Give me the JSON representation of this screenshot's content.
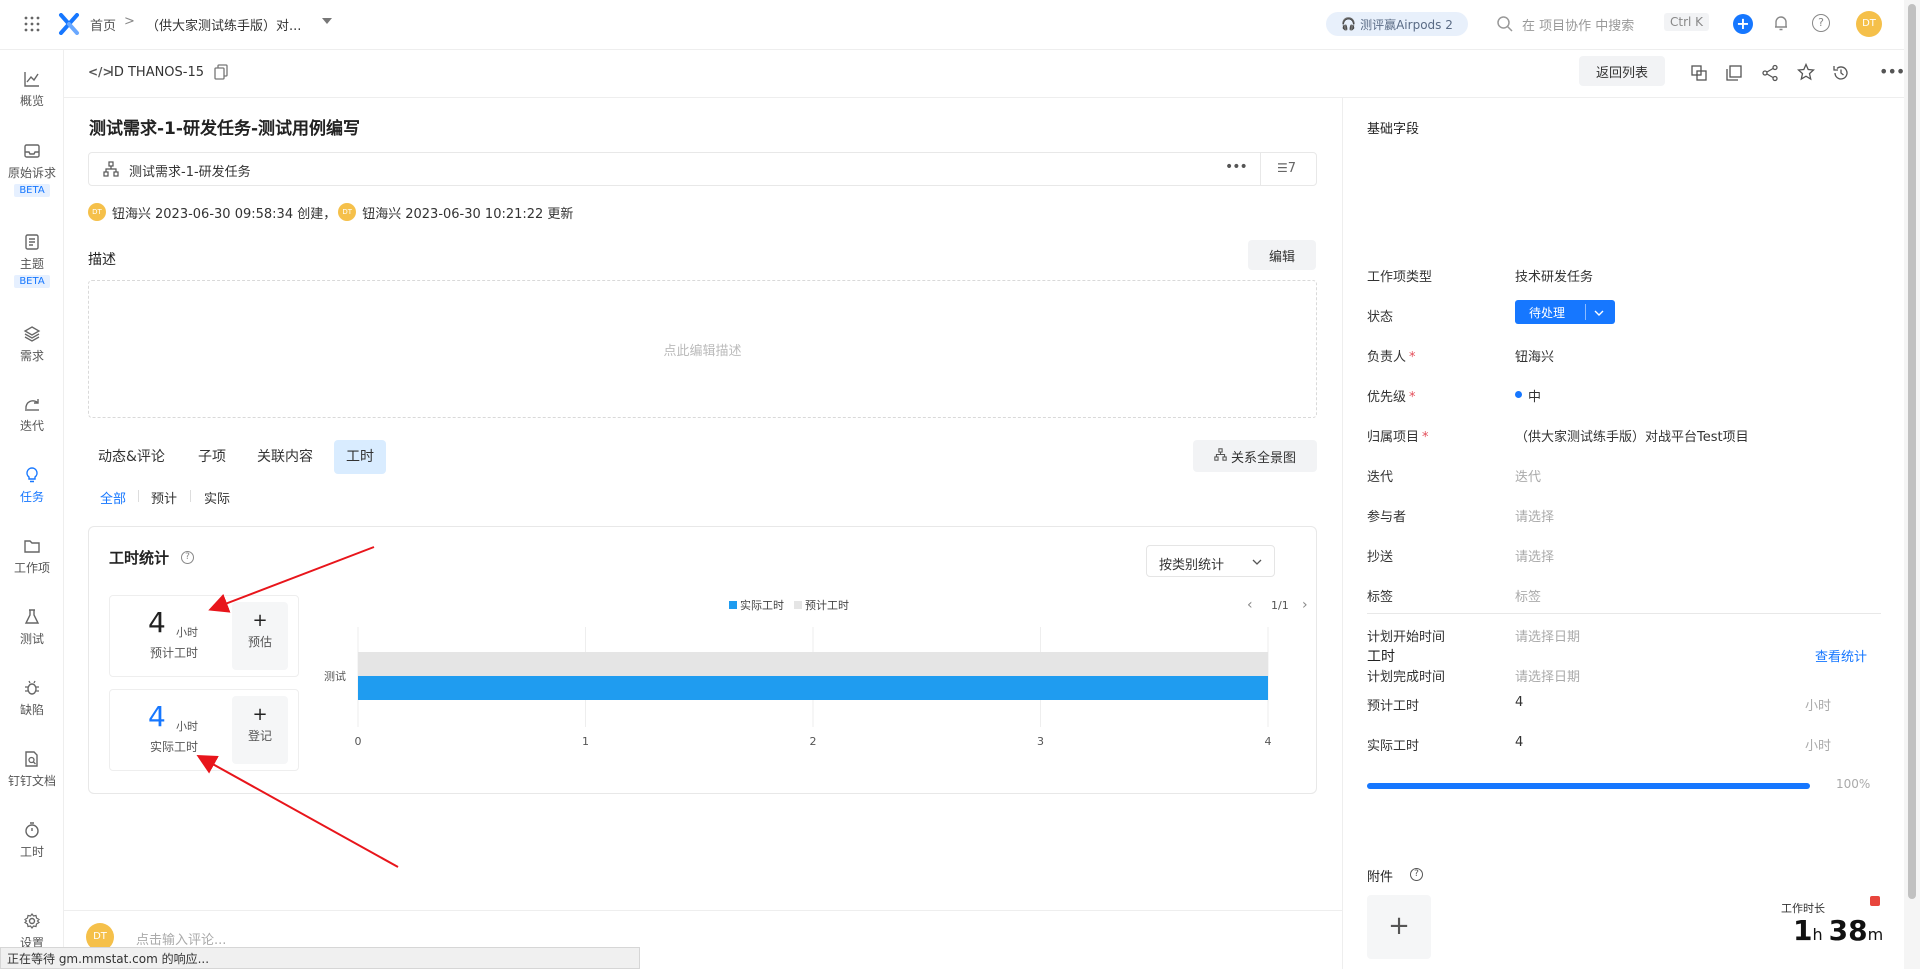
{
  "topbar": {
    "breadcrumb_home": "首页",
    "breadcrumb_sep": ">",
    "breadcrumb_project": "（供大家测试练手版）对...",
    "promo": "测评赢Airpods 2",
    "search_placeholder": "在 项目协作 中搜索",
    "shortcut": "Ctrl K",
    "avatar": "DT"
  },
  "nav": {
    "items": [
      {
        "label": "概览",
        "icon": "chart-line-icon"
      },
      {
        "label": "原始诉求",
        "icon": "inbox-icon",
        "badge": "BETA"
      },
      {
        "label": "主题",
        "icon": "document-icon",
        "badge": "BETA"
      },
      {
        "label": "需求",
        "icon": "layers-icon"
      },
      {
        "label": "迭代",
        "icon": "iteration-icon"
      },
      {
        "label": "任务",
        "icon": "bulb-icon"
      },
      {
        "label": "工作项",
        "icon": "folder-icon"
      },
      {
        "label": "测试",
        "icon": "flask-icon"
      },
      {
        "label": "缺陷",
        "icon": "bug-icon"
      },
      {
        "label": "钉钉文档",
        "icon": "file-search-icon"
      },
      {
        "label": "工时",
        "icon": "timer-icon"
      },
      {
        "label": "设置",
        "icon": "gear-icon"
      }
    ]
  },
  "idbar": {
    "id_text": "ID THANOS-15",
    "back_label": "返回列表"
  },
  "main": {
    "title": "测试需求-1-研发任务-测试用例编写",
    "parent_task": "测试需求-1-研发任务",
    "subitem_count": "7",
    "meta": {
      "creator_avatar": "DT",
      "creator": "钮海兴",
      "created": "2023-06-30 09:58:34 创建，",
      "updater_avatar": "DT",
      "updater": "钮海兴",
      "updated": "2023-06-30 10:21:22 更新"
    },
    "description_label": "描述",
    "edit_label": "编辑",
    "description_placeholder": "点此编辑描述",
    "tabs": [
      "动态&评论",
      "子项",
      "关联内容",
      "工时"
    ],
    "relation_button": "关系全景图",
    "subtabs": [
      "全部",
      "预计",
      "实际"
    ],
    "worktime": {
      "title": "工时统计",
      "group_select": "按类别统计",
      "estimated": {
        "value": "4",
        "unit": "小时",
        "label": "预计工时",
        "action": "预估"
      },
      "actual": {
        "value": "4",
        "unit": "小时",
        "label": "实际工时",
        "action": "登记"
      },
      "pager": "1/1"
    },
    "comment_avatar": "DT",
    "comment_placeholder": "点击输入评论..."
  },
  "chart_data": {
    "type": "bar",
    "orientation": "horizontal",
    "categories": [
      "测试"
    ],
    "series": [
      {
        "name": "实际工时",
        "values": [
          4
        ],
        "color": "#1f9cf0"
      },
      {
        "name": "预计工时",
        "values": [
          4
        ],
        "color": "#e5e5e5"
      }
    ],
    "x_ticks": [
      "0",
      "1",
      "2",
      "3",
      "4"
    ],
    "xlim": [
      0,
      4
    ],
    "legend": "top-center",
    "grid": true
  },
  "right": {
    "section_title": "基础字段",
    "fields": [
      {
        "label": "工作项类型",
        "value": "技术研发任务",
        "required": false,
        "placeholder": false
      },
      {
        "label": "状态",
        "value": "待处理",
        "required": false,
        "placeholder": false
      },
      {
        "label": "负责人",
        "value": "钮海兴",
        "required": true,
        "placeholder": false
      },
      {
        "label": "优先级",
        "value": "中",
        "required": true,
        "placeholder": false
      },
      {
        "label": "归属项目",
        "value": "（供大家测试练手版）对战平台Test项目",
        "required": true,
        "placeholder": false
      },
      {
        "label": "迭代",
        "value": "迭代",
        "required": false,
        "placeholder": true
      },
      {
        "label": "参与者",
        "value": "请选择",
        "required": false,
        "placeholder": true
      },
      {
        "label": "抄送",
        "value": "请选择",
        "required": false,
        "placeholder": true
      },
      {
        "label": "标签",
        "value": "标签",
        "required": false,
        "placeholder": true
      },
      {
        "label": "计划开始时间",
        "value": "请选择日期",
        "required": false,
        "placeholder": true
      },
      {
        "label": "计划完成时间",
        "value": "请选择日期",
        "required": false,
        "placeholder": true
      }
    ],
    "required_mark": "*",
    "worktime": {
      "title": "工时",
      "link": "查看统计",
      "estimated_label": "预计工时",
      "estimated_value": "4",
      "actual_label": "实际工时",
      "actual_value": "4",
      "unit": "小时",
      "progress": 1.0,
      "progress_text": "100%"
    },
    "attachment_title": "附件",
    "timer": {
      "label": "工作时长",
      "hours": "1",
      "h": "h",
      "minutes": "38",
      "m": "m"
    }
  },
  "statusbar": "正在等待 gm.mmstat.com 的响应...",
  "colors": {
    "accent": "#1677ff",
    "bar_actual": "#1f9cf0",
    "bar_estimated": "#e5e5e5",
    "arrow": "#e8151b",
    "avatar": "#f5c04a"
  }
}
